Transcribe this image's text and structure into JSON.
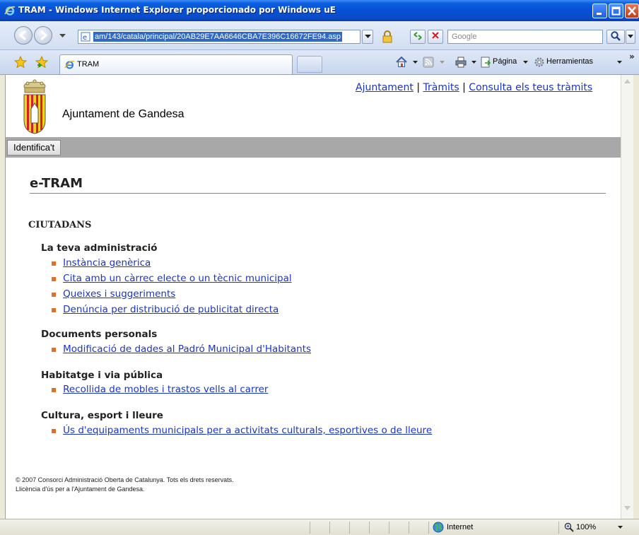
{
  "window": {
    "title": "TRAM - Windows Internet Explorer proporcionado por Windows uE"
  },
  "address_bar": {
    "url": "am/143/catala/principal/20AB29E7AA6646CBA7E396C16672FE94.asp",
    "search_placeholder": "Google"
  },
  "tabs": [
    {
      "label": "TRAM"
    }
  ],
  "command_bar": {
    "page_label": "Página",
    "tools_label": "Herramientas"
  },
  "page": {
    "top_links": [
      "Ajuntament",
      "Tràmits",
      "Consulta els teus tràmits"
    ],
    "separator": "|",
    "town_name": "Ajuntament de Gandesa",
    "identify_button": "Identifica't",
    "heading": "e-TRAM",
    "section": "CIUTADANS",
    "categories": [
      {
        "title": "La teva administració",
        "items": [
          "Instància genèrica",
          "Cita amb un càrrec electe o un tècnic municipal",
          "Queixes i suggeriments",
          "Denúncia per distribució de publicitat directa"
        ]
      },
      {
        "title": "Documents personals",
        "items": [
          "Modificació de dades al Padró Municipal d'Habitants"
        ]
      },
      {
        "title": "Habitatge i via pública",
        "items": [
          "Recollida de mobles i trastos vells al carrer"
        ]
      },
      {
        "title": "Cultura, esport i lleure",
        "items": [
          "Ús d'equipaments municipals per a activitats culturals, esportives o de lleure"
        ]
      }
    ],
    "footer": [
      "© 2007 Consorci Administració Oberta de Catalunya. Tots els drets reservats.",
      "Llicència d'ús per a l'Ajuntament de Gandesa."
    ]
  },
  "status_bar": {
    "zone": "Internet",
    "zoom": "100%"
  },
  "colors": {
    "link": "#1a35c8",
    "bullet": "#e07020",
    "gray_bar": "#a8a8a8",
    "title_bar": "#0a5fe0"
  }
}
